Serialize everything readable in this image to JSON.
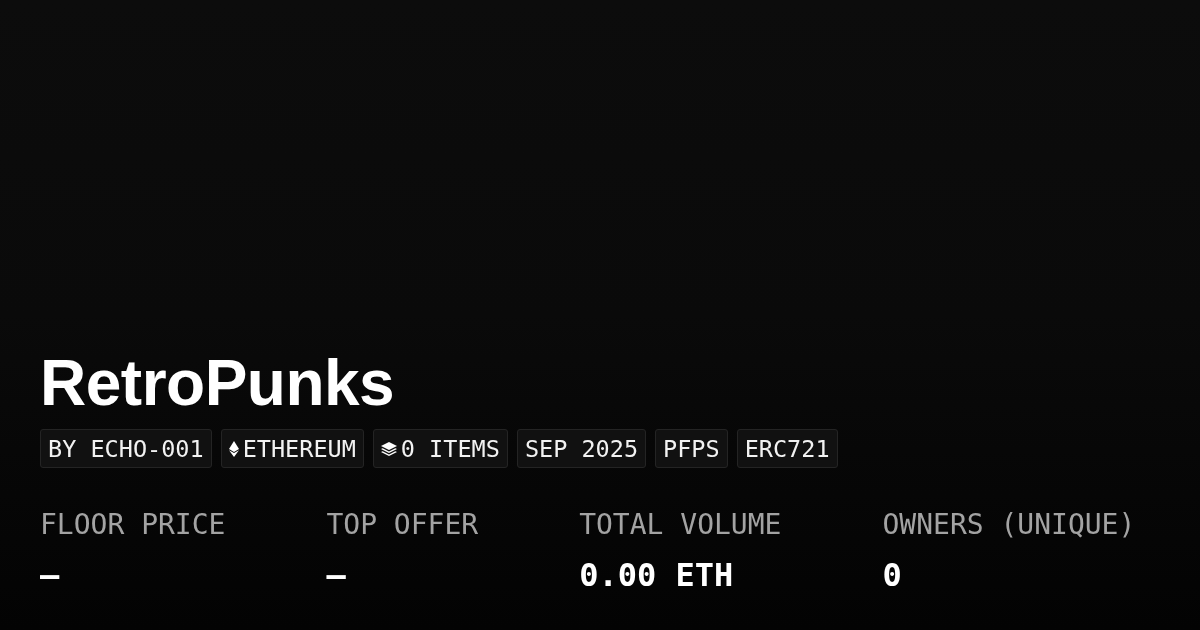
{
  "collection": {
    "title": "RetroPunks"
  },
  "tags": [
    {
      "kind": "text",
      "label": "BY ECHO-001"
    },
    {
      "kind": "chain",
      "label": "ETHEREUM"
    },
    {
      "kind": "items",
      "label": "0 ITEMS"
    },
    {
      "kind": "text",
      "label": "SEP 2025"
    },
    {
      "kind": "text",
      "label": "PFPS"
    },
    {
      "kind": "text",
      "label": "ERC721"
    }
  ],
  "stats": [
    {
      "label": "FLOOR PRICE",
      "value": "—"
    },
    {
      "label": "TOP OFFER",
      "value": "—"
    },
    {
      "label": "TOTAL VOLUME",
      "value": "0.00 ETH"
    },
    {
      "label": "OWNERS (UNIQUE)",
      "value": "0"
    }
  ]
}
